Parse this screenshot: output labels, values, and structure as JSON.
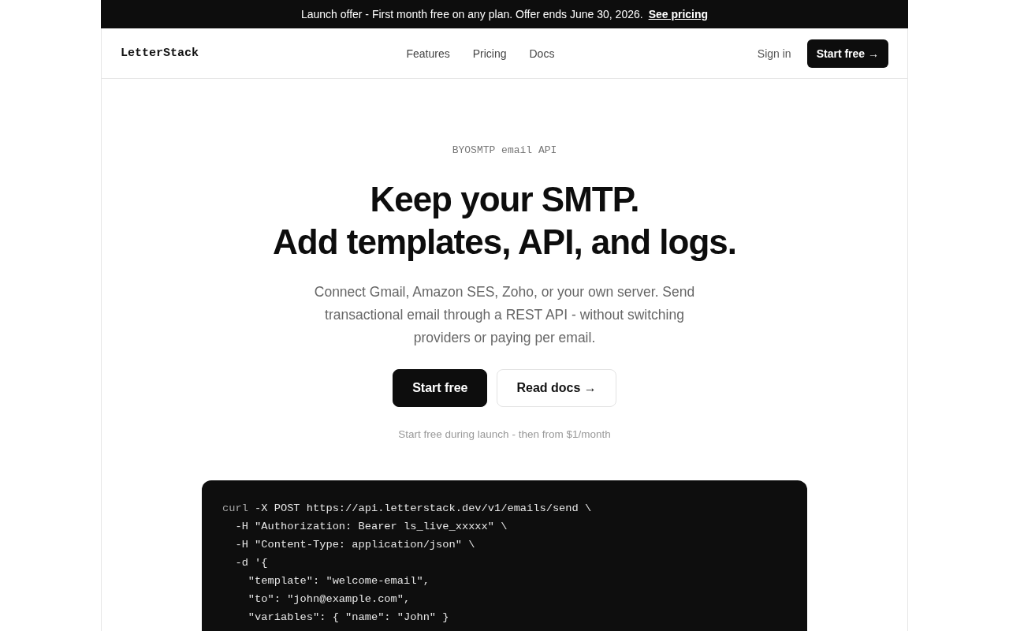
{
  "banner": {
    "text": "Launch offer - First month free on any plan. Offer ends June 30, 2026.",
    "link": "See pricing"
  },
  "nav": {
    "logo": "LetterStack",
    "links": [
      "Features",
      "Pricing",
      "Docs"
    ],
    "sign_in": "Sign in",
    "cta": "Start free →"
  },
  "hero": {
    "eyebrow": "BYOSMTP email API",
    "headline": [
      "Keep your SMTP.",
      "Add templates, API, and logs."
    ],
    "description": "Connect Gmail, Amazon SES, Zoho, or your own server. Send transactional email through a REST API - without switching providers or paying per email.",
    "buttons": [
      {
        "label": "Start free",
        "kind": "primary"
      },
      {
        "label": "Read docs →",
        "kind": "secondary"
      }
    ],
    "note": "Start free during launch - then from $1/month"
  },
  "code": {
    "lines": [
      {
        "command": "curl",
        "text": " -X POST https://api.letterstack.dev/v1/emails/send \\"
      },
      {
        "text": "  -H \"Authorization: Bearer ls_live_xxxxx\" \\"
      },
      {
        "text": "  -H \"Content-Type: application/json\" \\"
      },
      {
        "text": "  -d '{"
      },
      {
        "text": "    \"template\": \"welcome-email\","
      },
      {
        "text": "    \"to\": \"john@example.com\","
      },
      {
        "text": "    \"variables\": { \"name\": \"John\" }"
      }
    ]
  }
}
